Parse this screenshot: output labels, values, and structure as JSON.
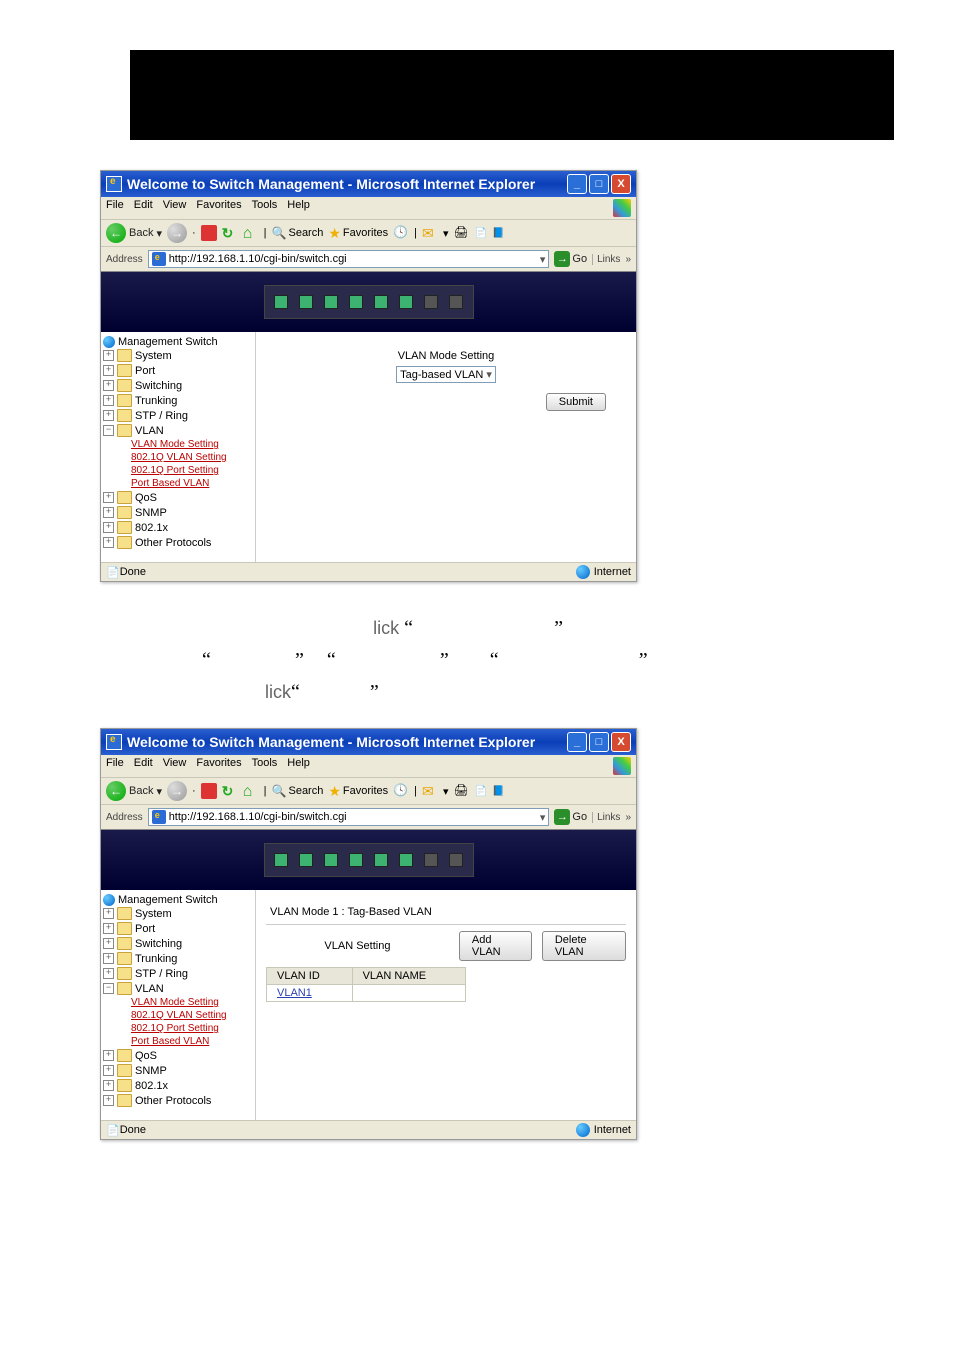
{
  "window": {
    "title": "Welcome to Switch Management - Microsoft Internet Explorer",
    "min": "_",
    "max": "□",
    "close": "X"
  },
  "menu": {
    "file": "File",
    "edit": "Edit",
    "view": "View",
    "favorites": "Favorites",
    "tools": "Tools",
    "help": "Help"
  },
  "toolbar": {
    "back": "Back",
    "search": "Search",
    "favorites": "Favorites"
  },
  "address": {
    "label": "Address",
    "url": "http://192.168.1.10/cgi-bin/switch.cgi",
    "go": "Go",
    "links": "Links"
  },
  "tree": {
    "root": "Management Switch",
    "system": "System",
    "port": "Port",
    "switching": "Switching",
    "trunking": "Trunking",
    "stp": "STP / Ring",
    "vlan": "VLAN",
    "vlan_mode": "VLAN Mode Setting",
    "vlan_8021q": "802.1Q VLAN Setting",
    "vlan_port": "802.1Q Port Setting",
    "vlan_portbased": "Port Based VLAN",
    "qos": "QoS",
    "snmp": "SNMP",
    "m8021x": "802.1x",
    "other": "Other Protocols"
  },
  "screen1": {
    "heading": "VLAN Mode Setting",
    "combo": "Tag-based VLAN",
    "submit": "Submit"
  },
  "status": {
    "done": "Done",
    "internet": "Internet"
  },
  "caption": {
    "w1": "lick",
    "w2": "lick"
  },
  "screen2": {
    "mode": "VLAN Mode 1 : Tag-Based VLAN",
    "setting": "VLAN Setting",
    "add": "Add VLAN",
    "del": "Delete VLAN",
    "col_id": "VLAN ID",
    "col_name": "VLAN NAME",
    "entry": "VLAN1"
  }
}
